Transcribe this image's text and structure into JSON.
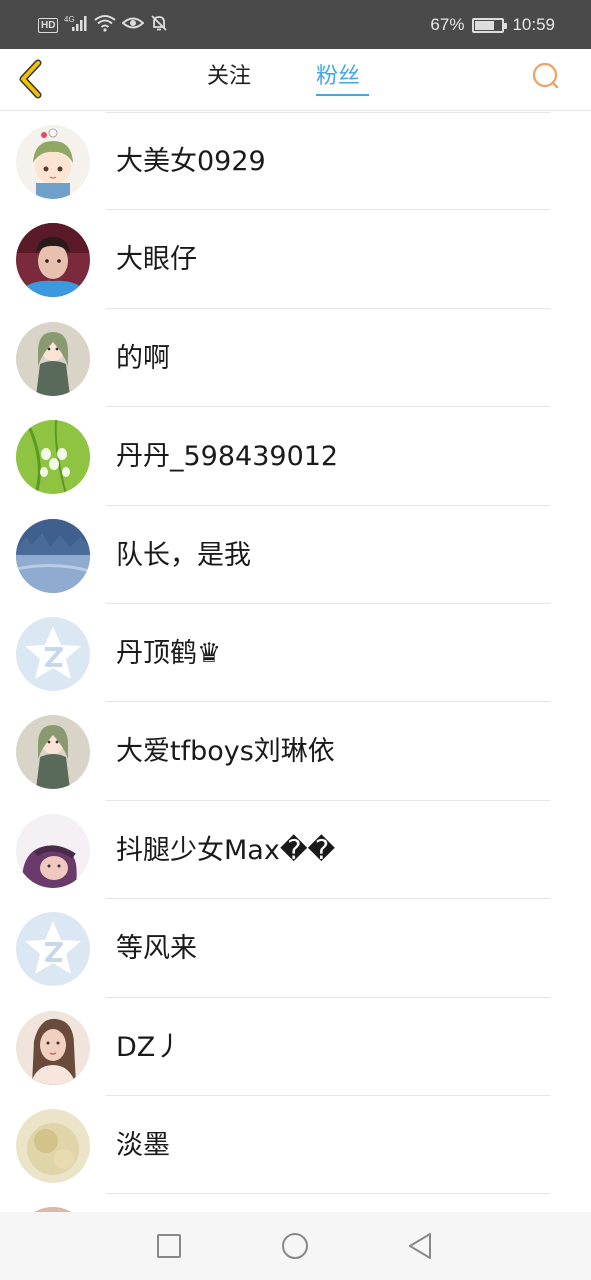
{
  "status_bar": {
    "hd_label": "HD",
    "network_label": "4G",
    "battery_text": "67%",
    "battery_level": 0.67,
    "time": "10:59"
  },
  "header": {
    "tabs": [
      {
        "label": "关注",
        "active": false
      },
      {
        "label": "粉丝",
        "active": true
      }
    ],
    "accent_color": "#3fa9e6",
    "back_icon_color": "#f2c200",
    "search_icon_color": "#f0a060"
  },
  "fans": [
    {
      "name": "大美女0929",
      "avatar": "anime-boy-avatar"
    },
    {
      "name": "大眼仔",
      "avatar": "photo-avatar"
    },
    {
      "name": "的啊",
      "avatar": "anime-girl-avatar"
    },
    {
      "name": "丹丹_598439012",
      "avatar": "green-plant-avatar"
    },
    {
      "name": "队长，是我",
      "avatar": "snow-landscape-avatar"
    },
    {
      "name": "丹顶鹤♛",
      "avatar": "default-qq-avatar"
    },
    {
      "name": "大爱tfboys刘琳依",
      "avatar": "anime-girl-avatar"
    },
    {
      "name": "抖腿少女Max��",
      "avatar": "purple-girl-avatar"
    },
    {
      "name": "等风来",
      "avatar": "default-qq-avatar"
    },
    {
      "name": "DZ丿",
      "avatar": "portrait-photo-avatar"
    },
    {
      "name": "淡墨",
      "avatar": "faded-photo-avatar"
    }
  ],
  "navigation": {
    "buttons": [
      "recent-apps",
      "home",
      "back"
    ]
  }
}
